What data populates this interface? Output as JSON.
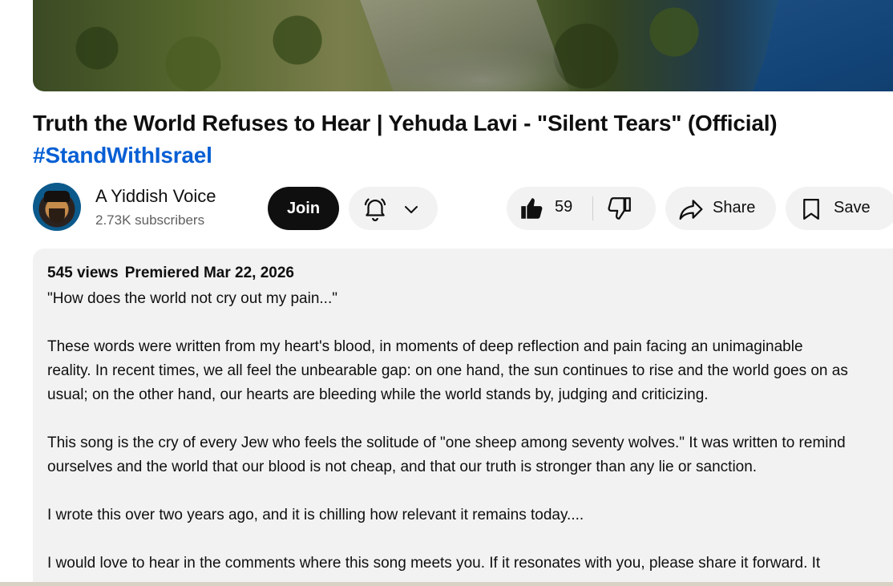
{
  "video": {
    "title": "Truth the World Refuses to Hear | Yehuda Lavi - \"Silent Tears\" (Official)",
    "hashtag": "#StandWithIsrael"
  },
  "channel": {
    "name": "A Yiddish Voice",
    "subscribers": "2.73K subscribers",
    "join_label": "Join"
  },
  "actions": {
    "like_count": "59",
    "share_label": "Share",
    "save_label": "Save"
  },
  "description": {
    "views": "545 views",
    "premiered": "Premiered Mar 22, 2026",
    "lines": [
      "\"How does the world not cry out my pain...\"",
      "",
      "These words were written from my heart's blood, in moments of deep reflection and pain facing an unimaginable",
      "reality. In recent times, we all feel the unbearable gap: on one hand, the sun continues to rise and the world goes on as",
      "usual; on the other hand, our hearts are bleeding while the world stands by, judging and criticizing.",
      "",
      "This song is the cry of every Jew who feels the solitude of \"one sheep among seventy wolves.\" It was written to remind",
      "ourselves and the world that our blood is not cheap, and that our truth is stronger than any lie or sanction.",
      "",
      "I wrote this over two years ago, and it is chilling how relevant it remains today....",
      "",
      "I would love to hear in the comments where this song meets you. If it resonates with you, please share it forward. It"
    ]
  },
  "colors": {
    "hashtag": "#065fd4",
    "pill_bg": "#f2f2f2",
    "join_bg": "#0f0f0f"
  }
}
